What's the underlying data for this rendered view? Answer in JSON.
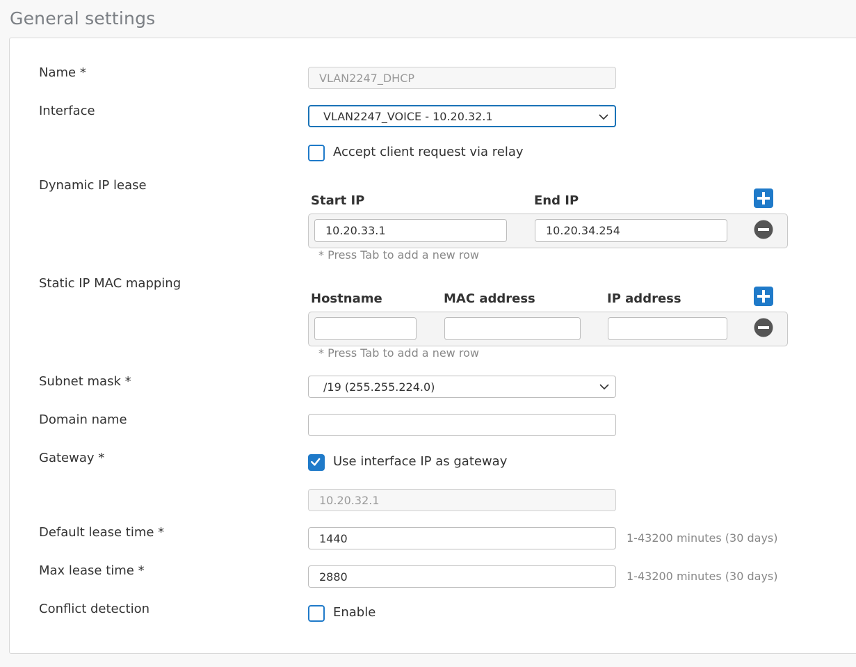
{
  "section": {
    "title": "General settings"
  },
  "fields": {
    "name": {
      "label": "Name *",
      "value": "VLAN2247_DHCP"
    },
    "interface": {
      "label": "Interface",
      "value": "VLAN2247_VOICE - 10.20.32.1"
    },
    "relay": {
      "label": "Accept client request via relay",
      "checked": false
    },
    "dynamic_ip_lease": {
      "label": "Dynamic IP lease",
      "columns": [
        "Start IP",
        "End IP"
      ],
      "rows": [
        {
          "start_ip": "10.20.33.1",
          "end_ip": "10.20.34.254"
        }
      ],
      "hint": "* Press Tab to add a new row"
    },
    "static_mapping": {
      "label": "Static IP MAC mapping",
      "columns": [
        "Hostname",
        "MAC address",
        "IP address"
      ],
      "rows": [
        {
          "hostname": "",
          "mac": "",
          "ip": ""
        }
      ],
      "hint": "* Press Tab to add a new row"
    },
    "subnet_mask": {
      "label": "Subnet mask *",
      "value": "/19 (255.255.224.0)"
    },
    "domain_name": {
      "label": "Domain name",
      "value": ""
    },
    "gateway": {
      "label": "Gateway *",
      "use_interface_label": "Use interface IP as gateway",
      "use_interface_checked": true,
      "value": "10.20.32.1"
    },
    "default_lease": {
      "label": "Default lease time *",
      "value": "1440",
      "unit": "1-43200 minutes (30 days)"
    },
    "max_lease": {
      "label": "Max lease time *",
      "value": "2880",
      "unit": "1-43200 minutes (30 days)"
    },
    "conflict_detection": {
      "label": "Conflict detection",
      "enable_label": "Enable",
      "checked": false
    }
  },
  "colors": {
    "accent": "#1f7ac9",
    "remove": "#555555"
  },
  "icons": {
    "add": "plus-icon",
    "remove": "minus-icon",
    "dropdown": "chevron-down-icon",
    "check": "check-icon"
  }
}
